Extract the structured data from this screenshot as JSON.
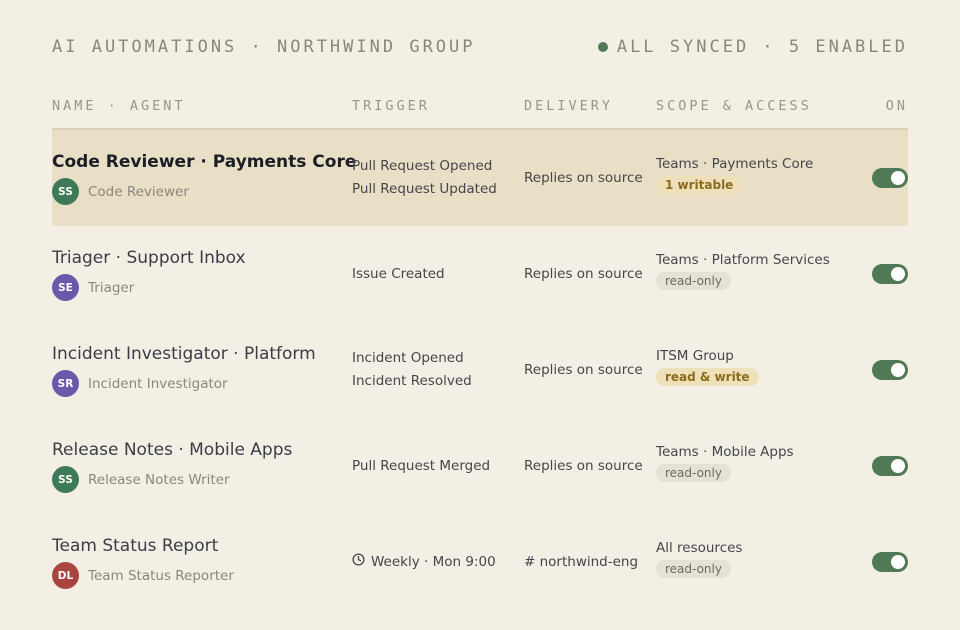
{
  "header": {
    "title": "AI AUTOMATIONS · NORTHWIND GROUP",
    "status": "ALL SYNCED · 5 ENABLED",
    "status_color": "#4f7a55"
  },
  "columns": {
    "name": "NAME · AGENT",
    "trigger": "TRIGGER",
    "delivery": "DELIVERY",
    "scope": "SCOPE & ACCESS",
    "on": "ON"
  },
  "rows": [
    {
      "title": "Code Reviewer · Payments Core",
      "initials": "SS",
      "avatar_color": "#3e7a57",
      "agent": "Code Reviewer",
      "triggers": [
        "Pull Request Opened",
        "Pull Request Updated"
      ],
      "delivery": "Replies on source",
      "scope": "Teams · Payments Core",
      "access": "1 writable",
      "access_kind": "write",
      "enabled": true,
      "selected": true
    },
    {
      "title": "Triager · Support Inbox",
      "initials": "SE",
      "avatar_color": "#6a58a8",
      "agent": "Triager",
      "triggers": [
        "Issue Created"
      ],
      "delivery": "Replies on source",
      "scope": "Teams · Platform Services",
      "access": "read-only",
      "access_kind": "read",
      "enabled": true,
      "selected": false
    },
    {
      "title": "Incident Investigator · Platform",
      "initials": "SR",
      "avatar_color": "#6a58a8",
      "agent": "Incident Investigator",
      "triggers": [
        "Incident Opened",
        "Incident Resolved"
      ],
      "delivery": "Replies on source",
      "scope": "ITSM Group",
      "access": "read & write",
      "access_kind": "write",
      "enabled": true,
      "selected": false
    },
    {
      "title": "Release Notes · Mobile Apps",
      "initials": "SS",
      "avatar_color": "#3e7a57",
      "agent": "Release Notes Writer",
      "triggers": [
        "Pull Request Merged"
      ],
      "delivery": "Replies on source",
      "scope": "Teams · Mobile Apps",
      "access": "read-only",
      "access_kind": "read",
      "enabled": true,
      "selected": false
    },
    {
      "title": "Team Status Report",
      "initials": "DL",
      "avatar_color": "#a8453f",
      "agent": "Team Status Reporter",
      "triggers": [
        "Weekly · Mon 9:00"
      ],
      "trigger_icon": "clock-icon",
      "delivery": "# northwind-eng",
      "scope": "All resources",
      "access": "read-only",
      "access_kind": "read",
      "enabled": true,
      "selected": false
    }
  ]
}
